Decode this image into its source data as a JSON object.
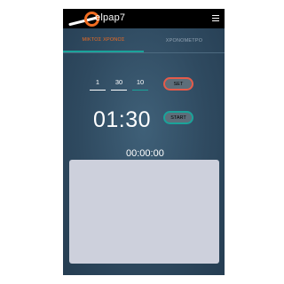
{
  "header": {
    "logo_text": "elpap7",
    "menu_icon": "hamburger-menu-icon",
    "brand_color": "#f26d21"
  },
  "tabs": [
    {
      "label": "ΜΙΚΤΟΣ ΧΡΟΝΟΣ",
      "selected": true
    },
    {
      "label": "ΧΡΟΝΟΜΕΤΡΟ",
      "selected": false
    }
  ],
  "timer_inputs": {
    "hours": "1",
    "minutes": "30",
    "seconds": "10"
  },
  "buttons": {
    "set_label": "SET",
    "start_label": "START"
  },
  "display": {
    "big_time": "01:30",
    "counter": "00:00:00"
  },
  "colors": {
    "accent": "#1aa39a",
    "set_border": "#e55b4a",
    "panel": "#cdd0dc"
  }
}
